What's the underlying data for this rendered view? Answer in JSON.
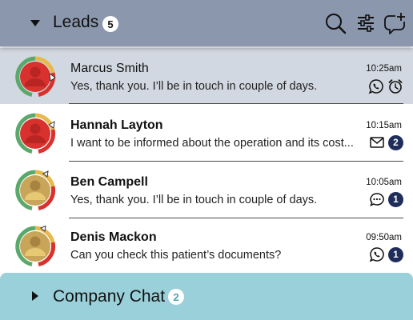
{
  "header": {
    "title": "Leads",
    "count": "5",
    "icons": [
      "search-icon",
      "filter-sliders-icon",
      "new-chat-icon"
    ]
  },
  "leads": [
    {
      "name": "Marcus Smith",
      "preview": "Yes, thank you. I’ll be in touch in couple of days.",
      "time": "10:25am",
      "channel_icon": "whatsapp-icon",
      "status_icon": "alarm-clock-icon",
      "unread": "",
      "selected": true,
      "bold": false,
      "avatar_color": "#d8312e",
      "ring_colors": [
        "#d8312e",
        "#e7b84a",
        "#5aa86a"
      ]
    },
    {
      "name": "Hannah Layton",
      "preview": "I want to be informed about the operation and its cost...",
      "time": "10:15am",
      "channel_icon": "mail-icon",
      "status_icon": "",
      "unread": "2",
      "selected": false,
      "bold": true,
      "avatar_color": "#d8312e",
      "ring_colors": [
        "#d8312e",
        "#e7b84a",
        "#5aa86a"
      ]
    },
    {
      "name": "Ben Campell",
      "preview": "Yes, thank you. I’ll be in touch in couple of days.",
      "time": "10:05am",
      "channel_icon": "chat-bubble-icon",
      "status_icon": "",
      "unread": "1",
      "selected": false,
      "bold": true,
      "avatar_color": "#c9a55a",
      "ring_colors": [
        "#d8312e",
        "#e7b84a",
        "#5aa86a"
      ]
    },
    {
      "name": "Denis Mackon",
      "preview": "Can you check this patient’s documents?",
      "time": "09:50am",
      "channel_icon": "whatsapp-icon",
      "status_icon": "",
      "unread": "1",
      "selected": false,
      "bold": true,
      "avatar_color": "#c9a55a",
      "ring_colors": [
        "#d8312e",
        "#e7b84a",
        "#5aa86a"
      ]
    }
  ],
  "footer": {
    "title": "Company Chat",
    "count": "2"
  },
  "colors": {
    "header_bg": "#8a97ad",
    "selected_row_bg": "#d2d8e1",
    "footer_bg": "#9ad0d9",
    "unread_badge": "#1f2d5a"
  }
}
